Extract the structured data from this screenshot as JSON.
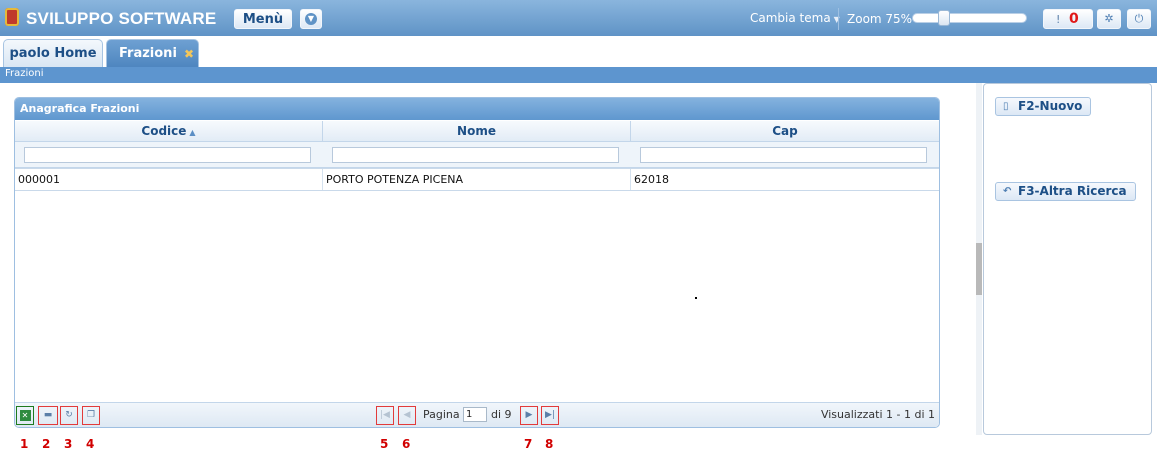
{
  "header": {
    "app_name": "SVILUPPO SOFTWARE",
    "menu_label": "Menù",
    "theme_label": "Cambia tema",
    "zoom_label": "Zoom 75%",
    "zoom_fraction": 0.25,
    "notifications_count": "0"
  },
  "tabs": [
    {
      "label": "paolo Home",
      "active": false
    },
    {
      "label": "Frazioni",
      "active": true
    }
  ],
  "breadcrumb": "Frazioni",
  "grid": {
    "title": "Anagrafica Frazioni",
    "columns": [
      "Codice",
      "Nome",
      "Cap"
    ],
    "rows": [
      {
        "codice": "000001",
        "nome": "PORTO POTENZA PICENA",
        "cap": "62018"
      }
    ],
    "pager": {
      "page_label": "Pagina",
      "page_value": "1",
      "of_label": "di 9",
      "summary": "Visualizzati 1 - 1 di 1"
    }
  },
  "side": {
    "new_button": "F2-Nuovo",
    "search_button": "F3-Altra Ricerca"
  },
  "annotations": [
    "1",
    "2",
    "3",
    "4",
    "5",
    "6",
    "7",
    "8"
  ]
}
